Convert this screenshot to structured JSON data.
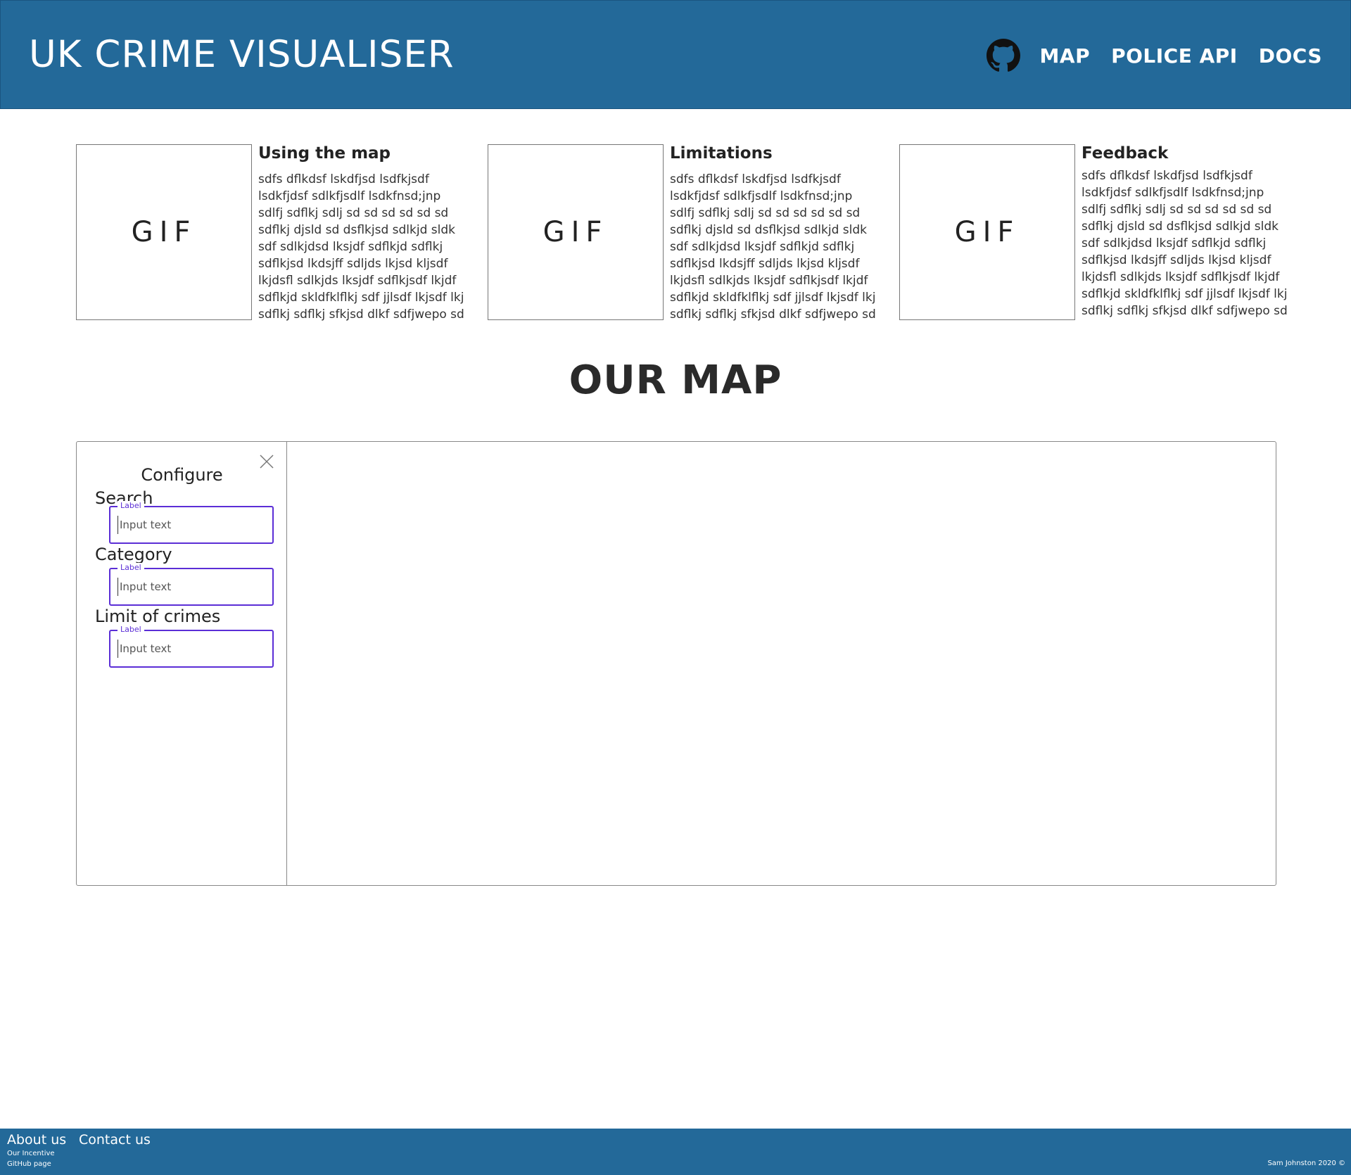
{
  "header": {
    "title": "UK CRIME VISUALISER",
    "github_icon": "github-icon",
    "nav": [
      "MAP",
      "POLICE API",
      "DOCS"
    ]
  },
  "cards": [
    {
      "gif": "GIF",
      "title": "Using the map",
      "lines": [
        "sdfs dflkdsf lskdfjsd lsdfkjsdf",
        "lsdkfjdsf sdlkfjsdlf lsdkfnsd;jnp",
        "sdlfj sdflkj sdlj sd sd sd sd sd sd",
        "sdflkj djsld sd dsflkjsd sdlkjd sldk",
        "sdf sdlkjdsd lksjdf sdflkjd sdflkj",
        "sdflkjsd lkdsjff sdljds lkjsd kljsdf",
        "lkjdsfl sdlkjds lksjdf sdflkjsdf lkjdf",
        "sdflkjd skldfklflkj sdf jjlsdf lkjsdf lkj",
        "sdflkj sdflkj sfkjsd dlkf sdfjwepo sd"
      ]
    },
    {
      "gif": "GIF",
      "title": "Limitations",
      "lines": [
        "sdfs dflkdsf lskdfjsd lsdfkjsdf",
        "lsdkfjdsf sdlkfjsdlf lsdkfnsd;jnp",
        "sdlfj sdflkj sdlj sd sd sd sd sd sd",
        "sdflkj djsld sd dsflkjsd sdlkjd sldk",
        "sdf sdlkjdsd lksjdf sdflkjd sdflkj",
        "sdflkjsd lkdsjff sdljds lkjsd kljsdf",
        "lkjdsfl sdlkjds lksjdf sdflkjsdf lkjdf",
        "sdflkjd skldfklflkj sdf jjlsdf lkjsdf lkj",
        "sdflkj sdflkj sfkjsd dlkf sdfjwepo sd"
      ]
    },
    {
      "gif": "GIF",
      "title": "Feedback",
      "lines": [
        "sdfs dflkdsf lskdfjsd lsdfkjsdf",
        "lsdkfjdsf sdlkfjsdlf lsdkfnsd;jnp",
        "sdlfj sdflkj sdlj sd sd sd sd sd sd",
        "sdflkj djsld sd dsflkjsd sdlkjd sldk",
        "sdf sdlkjdsd lksjdf sdflkjd sdflkj",
        "sdflkjsd lkdsjff sdljds lkjsd kljsdf",
        "lkjdsfl sdlkjds lksjdf sdflkjsdf lkjdf",
        "sdflkjd skldfklflkj sdf jjlsdf lkjsdf lkj",
        "sdflkj sdflkj sfkjsd dlkf sdfjwepo sd"
      ]
    }
  ],
  "map_section": {
    "title": "OUR MAP",
    "config": {
      "title": "Configure",
      "close_icon": "close-icon",
      "fields": [
        {
          "label": "Search",
          "floating_label": "Label",
          "placeholder": "Input text",
          "value": ""
        },
        {
          "label": "Category",
          "floating_label": "Label",
          "placeholder": "Input text",
          "value": ""
        },
        {
          "label": "Limit of crimes",
          "floating_label": "Label",
          "placeholder": "Input text",
          "value": ""
        }
      ]
    }
  },
  "footer": {
    "about": {
      "heading": "About us",
      "links": [
        "Our Incentive",
        "GitHub page"
      ]
    },
    "contact": {
      "heading": "Contact us"
    },
    "copyright": "Sam Johnston 2020 ©"
  },
  "colors": {
    "brand_blue": "#236999",
    "input_accent": "#5b2ed6"
  }
}
